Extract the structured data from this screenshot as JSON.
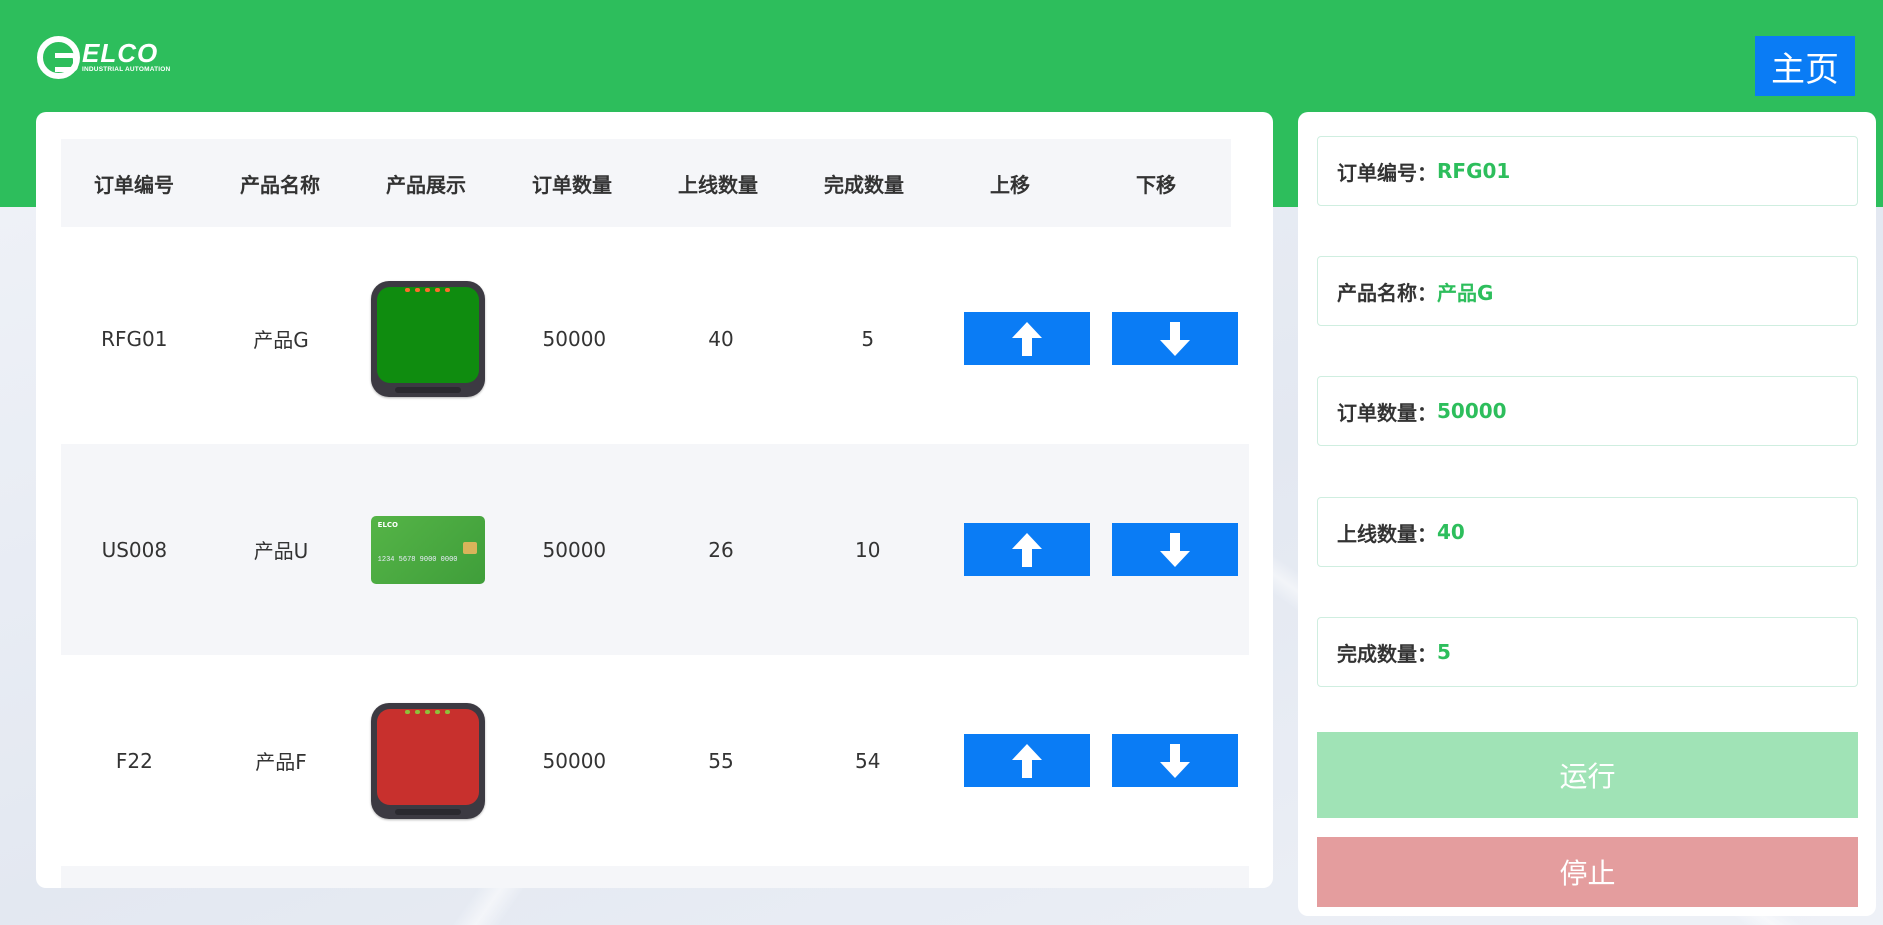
{
  "brand": {
    "logo_word": "ELCO",
    "logo_sub": "INDUSTRIAL AUTOMATION"
  },
  "header": {
    "home_label": "主页"
  },
  "table": {
    "headers": [
      "订单编号",
      "产品名称",
      "产品展示",
      "订单数量",
      "上线数量",
      "完成数量",
      "上移",
      "下移"
    ],
    "rows": [
      {
        "order_no": "RFG01",
        "product": "产品G",
        "image": "green-reader-device",
        "order_qty": "50000",
        "online_qty": "40",
        "done_qty": "5"
      },
      {
        "order_no": "US008",
        "product": "产品U",
        "image": "green-card",
        "order_qty": "50000",
        "online_qty": "26",
        "done_qty": "10"
      },
      {
        "order_no": "F22",
        "product": "产品F",
        "image": "red-reader-device",
        "order_qty": "50000",
        "online_qty": "55",
        "done_qty": "54"
      }
    ],
    "card_brand": "ELCO",
    "card_number": "1234 5678 9000 0000"
  },
  "detail": {
    "order_no_label": "订单编号：",
    "order_no": "RFG01",
    "product_label": "产品名称：",
    "product": "产品G",
    "order_qty_label": "订单数量：",
    "order_qty": "50000",
    "online_qty_label": "上线数量：",
    "online_qty": "40",
    "done_qty_label": "完成数量：",
    "done_qty": "5",
    "run_label": "运行",
    "stop_label": "停止"
  },
  "colors": {
    "brand_green": "#2dbe5c",
    "button_blue": "#0a7cf5",
    "run_disabled": "#a0e3b6",
    "stop_disabled": "#e49d9e"
  },
  "icons": {
    "up": "arrow-up-icon",
    "down": "arrow-down-icon"
  }
}
